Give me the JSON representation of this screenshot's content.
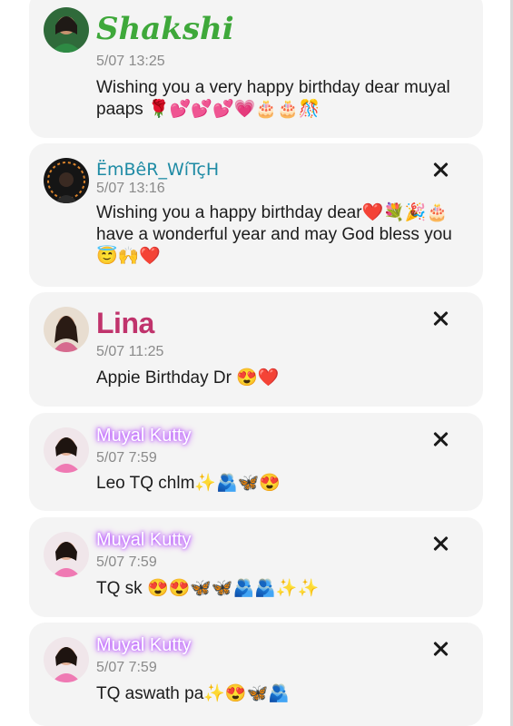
{
  "comments": [
    {
      "name": "Shakshi",
      "time": "5/07 13:25",
      "message": "Wishing you a very happy birthday dear muyal paaps 🌹💕💕💕💗🎂🎂🎊",
      "closable": false
    },
    {
      "name": "ËmBêR_WíTçH",
      "time": "5/07 13:16",
      "message": "Wishing you a happy birthday dear❤️💐🎉🎂 have a wonderful year and may God bless you 😇🙌❤️",
      "closable": true
    },
    {
      "name": "Lina",
      "time": "5/07 11:25",
      "message": "Appie Birthday Dr 😍❤️",
      "closable": true
    },
    {
      "name": "Muyal Kutty",
      "time": "5/07 7:59",
      "message": "Leo TQ chlm✨🫂🦋😍",
      "closable": true
    },
    {
      "name": "Muyal Kutty",
      "time": "5/07 7:59",
      "message": "TQ sk 😍😍🦋🦋🫂🫂✨✨",
      "closable": true
    },
    {
      "name": "Muyal Kutty",
      "time": "5/07 7:59",
      "message": "TQ aswath pa✨😍🦋🫂",
      "closable": true
    }
  ]
}
